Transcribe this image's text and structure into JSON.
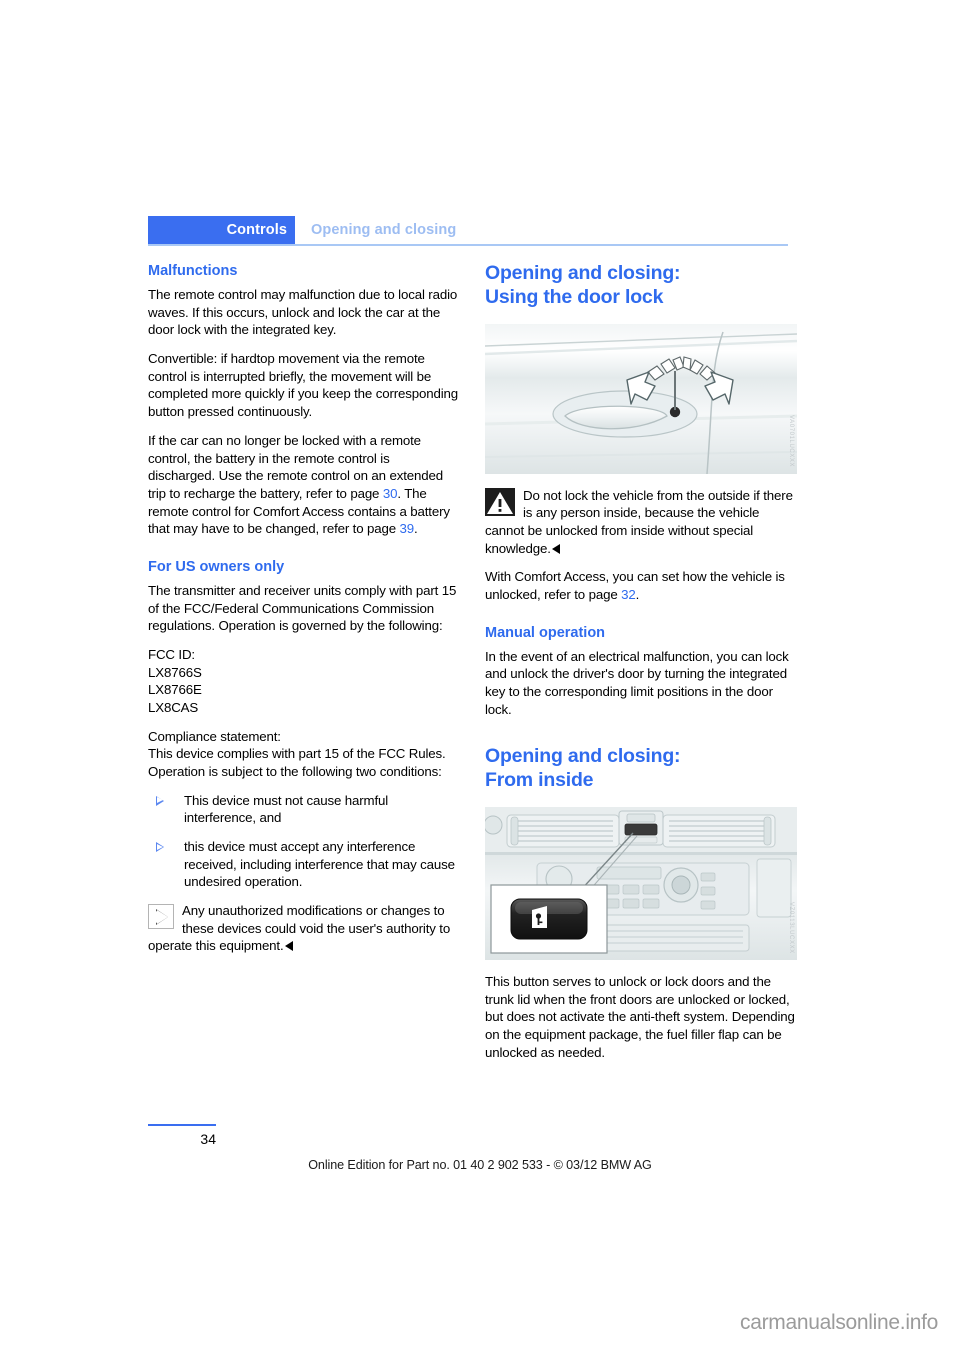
{
  "header": {
    "chapter": "Controls",
    "section": "Opening and closing"
  },
  "left_column": {
    "heading_malfunctions": "Malfunctions",
    "p1": "The remote control may malfunction due to local radio waves. If this occurs, unlock and lock the car at the door lock with the integrated key.",
    "p2": "Convertible: if hardtop movement via the remote control is interrupted briefly, the movement will be completed more quickly if you keep the corresponding button pressed continuously.",
    "p3_a": "If the car can no longer be locked with a remote control, the battery in the remote control is discharged. Use the remote control on an extended trip to recharge the battery, refer to page ",
    "p3_ref1": "30",
    "p3_b": ". The remote control for Comfort Access contains a battery that may have to be changed, refer to page ",
    "p3_ref2": "39",
    "p3_c": ".",
    "heading_us_owners": "For US owners only",
    "p4": "The transmitter and receiver units comply with part 15 of the FCC/Federal Communications Commission regulations. Operation is governed by the following:",
    "fcc_id_label": "FCC ID:",
    "fcc_ids": [
      "LX8766S",
      "LX8766E",
      "LX8CAS"
    ],
    "compliance_label": "Compliance statement:",
    "compliance_text": "This device complies with part 15 of the FCC Rules. Operation is subject to the following two conditions:",
    "bullets": [
      "This device must not cause harmful interference, and",
      "this device must accept any interference received, including interference that may cause undesired operation."
    ],
    "note_text": "Any unauthorized modifications or changes to these devices could void the user's authority to operate this equipment."
  },
  "right_column": {
    "heading_door_lock_line1": "Opening and closing:",
    "heading_door_lock_line2": "Using the door lock",
    "figure_door_lock_code": "VA0701LUCXXX",
    "warning_text": "Do not lock the vehicle from the outside if there is any person inside, because the vehicle cannot be unlocked from inside without special knowledge.",
    "p_comfort_a": "With Comfort Access, you can set how the vehicle is unlocked, refer to page ",
    "p_comfort_ref": "32",
    "p_comfort_b": ".",
    "heading_manual": "Manual operation",
    "p_manual": "In the event of an electrical malfunction, you can lock and unlock the driver's door by turning the integrated key to the corresponding limit positions in the door lock.",
    "heading_inside_line1": "Opening and closing:",
    "heading_inside_line2": "From inside",
    "figure_inside_code": "VZ0113LUCXXX",
    "p_button": "This button serves to unlock or lock doors and the trunk lid when the front doors are unlocked or locked, but does not activate the anti-theft system. Depending on the equipment package, the fuel filler flap can be unlocked as needed."
  },
  "footer": {
    "page_number": "34",
    "online_edition": "Online Edition for Part no. 01 40 2 902 533 - © 03/12 BMW AG",
    "watermark": "carmanualsonline.info"
  },
  "colors": {
    "accent_blue": "#3a6ef0",
    "heading_blue": "#2f6bee",
    "muted_blue": "#9dbdf2"
  }
}
